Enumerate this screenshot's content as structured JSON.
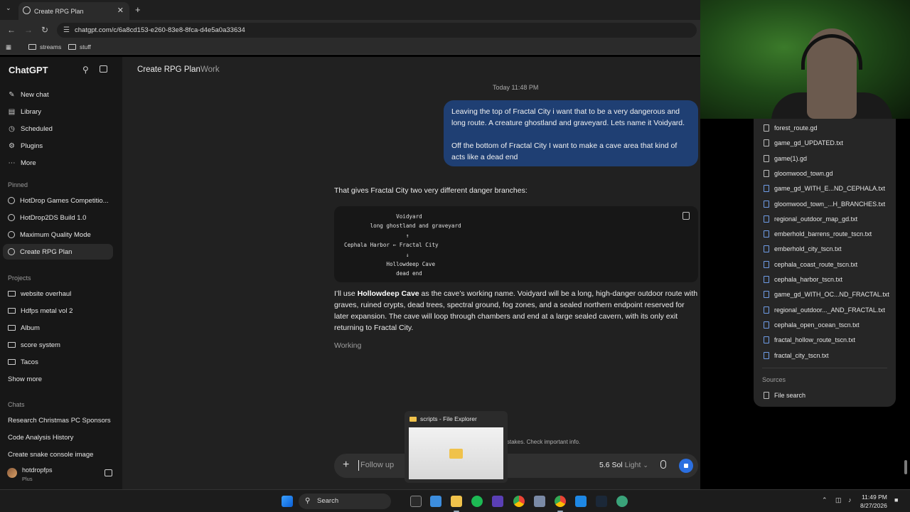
{
  "browser": {
    "tab_title": "Create RPG Plan",
    "url": "chatgpt.com/c/6a8cd153-e260-83e8-8fca-d4e5a0a33634",
    "bookmarks": [
      "streams",
      "stuff"
    ]
  },
  "sidebar": {
    "brand": "ChatGPT",
    "nav": [
      "New chat",
      "Library",
      "Scheduled",
      "Plugins",
      "More"
    ],
    "pinned_label": "Pinned",
    "pinned": [
      "HotDrop Games Competitio...",
      "HotDrop2DS Build 1.0",
      "Maximum Quality Mode",
      "Create RPG Plan"
    ],
    "projects_label": "Projects",
    "projects": [
      "website overhaul",
      "Hdfps metal vol 2",
      "Album",
      "score system",
      "Tacos"
    ],
    "show_more": "Show more",
    "chats_label": "Chats",
    "chats": [
      "Research Christmas PC Sponsors",
      "Code Analysis History",
      "Create snake console image"
    ],
    "user": {
      "name": "hotdropfps",
      "plan": "Plus"
    }
  },
  "main": {
    "title": "Create RPG Plan",
    "project": "Work",
    "timestamp": "Today 11:48 PM",
    "user_message": {
      "p1": "Leaving the top of Fractal City i want that to be a very dangerous and long route. A creature ghostland and graveyard. Lets name it Voidyard.",
      "p2": "Off the bottom of Fractal City I want to make a cave area that kind of acts like a dead end"
    },
    "response_intro": "That gives Fractal City two very different danger branches:",
    "code": "                Voidyard\n        long ghostland and graveyard\n                   ↑\nCephala Harbor ← Fractal City\n                   ↓\n             Hollowdeep Cave\n                dead end",
    "para_pre": "I’ll use ",
    "para_bold": "Hollowdeep Cave",
    "para_post": " as the cave’s working name. Voidyard will be a long, high-danger outdoor route with graves, ruined crypts, dead trees, spectral ground, fog zones, and a sealed northern endpoint reserved for later expansion. The cave will loop through chambers and end at a large sealed cavern, with its only exit returning to Fractal City.",
    "working": "Working",
    "disclaimer": "stakes. Check important info.",
    "composer": {
      "placeholder": "Follow up",
      "model": "5.6 Sol",
      "model_variant": "Light"
    }
  },
  "explorer_preview": {
    "title": "scripts - File Explorer"
  },
  "files": [
    {
      "name": "forest_route.gd",
      "type": "plain"
    },
    {
      "name": "game_gd_UPDATED.txt",
      "type": "plain"
    },
    {
      "name": "game(1).gd",
      "type": "plain"
    },
    {
      "name": "gloomwood_town.gd",
      "type": "plain"
    },
    {
      "name": "game_gd_WITH_E...ND_CEPHALA.txt",
      "type": "blue"
    },
    {
      "name": "gloomwood_town_...H_BRANCHES.txt",
      "type": "blue"
    },
    {
      "name": "regional_outdoor_map_gd.txt",
      "type": "blue"
    },
    {
      "name": "emberhold_barrens_route_tscn.txt",
      "type": "blue"
    },
    {
      "name": "emberhold_city_tscn.txt",
      "type": "blue"
    },
    {
      "name": "cephala_coast_route_tscn.txt",
      "type": "blue"
    },
    {
      "name": "cephala_harbor_tscn.txt",
      "type": "blue"
    },
    {
      "name": "game_gd_WITH_OC...ND_FRACTAL.txt",
      "type": "blue"
    },
    {
      "name": "regional_outdoor..._AND_FRACTAL.txt",
      "type": "blue"
    },
    {
      "name": "cephala_open_ocean_tscn.txt",
      "type": "blue"
    },
    {
      "name": "fractal_hollow_route_tscn.txt",
      "type": "blue"
    },
    {
      "name": "fractal_city_tscn.txt",
      "type": "blue"
    }
  ],
  "sources_label": "Sources",
  "sources_item": "File search",
  "taskbar": {
    "search": "Search",
    "time": "11:49 PM",
    "date": "8/27/2026"
  }
}
